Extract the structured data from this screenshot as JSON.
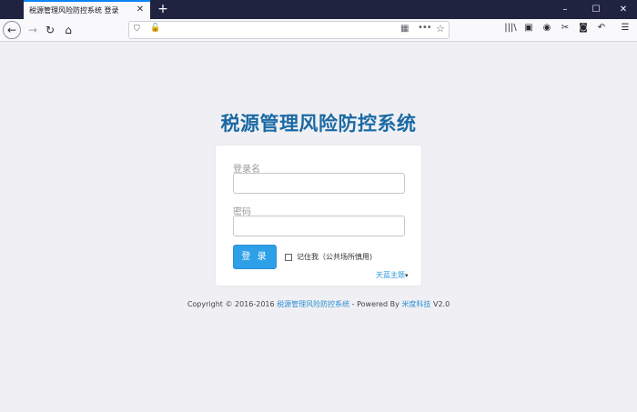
{
  "browser": {
    "tab_title": "税源管理风险防控系统 登录",
    "tab_close_glyph": "✕",
    "new_tab_glyph": "+",
    "window_controls": {
      "minimize": "–",
      "maximize": "☐",
      "close": "✕"
    },
    "icons": {
      "back": "←",
      "forward": "→",
      "reload": "↻",
      "home": "⌂",
      "shield": "⛉",
      "lock": "🔓",
      "qr": "▦",
      "more": "•••",
      "star": "☆",
      "library": "|||\\",
      "sidebar": "▣",
      "account": "◉",
      "screenshot": "✂",
      "chat": "◙",
      "undo": "↶",
      "menu": "☰"
    },
    "accent_color": "#0a84ff"
  },
  "page": {
    "title": "税源管理风险防控系统",
    "title_color": "#1a6aa4",
    "login": {
      "username_label": "登录名",
      "username_value": "",
      "password_label": "密码",
      "password_value": "",
      "submit_label": "登 录",
      "remember_label": "记住我（公共场所慎用)",
      "theme_label": "天蓝主题",
      "theme_caret": "▾",
      "button_color": "#2ea0e8"
    },
    "footer": {
      "prefix": "Copyright © 2016-2016 ",
      "system_link": "税源管理风险防控系统",
      "middle": " - Powered By ",
      "company_link": "米度科技",
      "version": " V2.0"
    }
  }
}
